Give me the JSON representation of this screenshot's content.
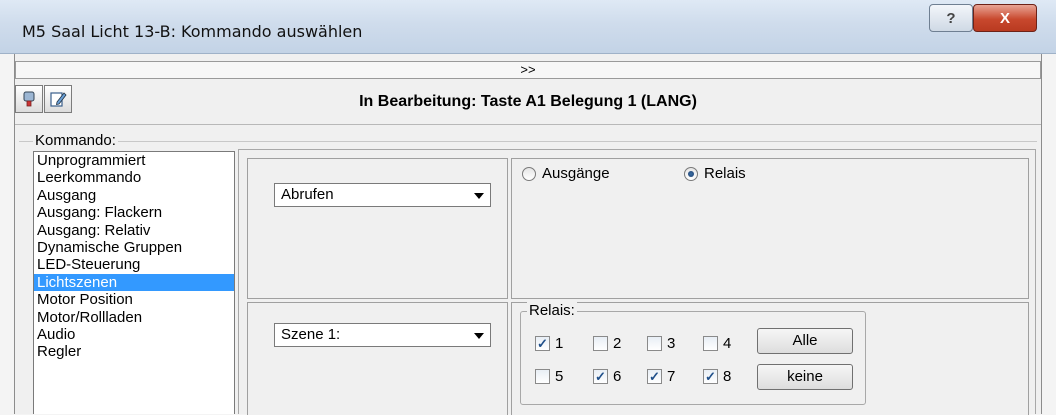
{
  "window": {
    "title": "M5 Saal Licht 13-B: Kommando auswählen",
    "help_label": "?",
    "close_label": "X"
  },
  "expand_label": ">>",
  "header_title": "In Bearbeitung: Taste A1 Belegung 1 (LANG)",
  "command_group_label": "Kommando:",
  "commands": [
    "Unprogrammiert",
    "Leerkommando",
    "Ausgang",
    "Ausgang: Flackern",
    "Ausgang: Relativ",
    "Dynamische Gruppen",
    "LED-Steuerung",
    "Lichtszenen",
    "Motor Position",
    "Motor/Rollladen",
    "Audio",
    "Regler"
  ],
  "selected_command": "Lichtszenen",
  "action_select": "Abrufen",
  "scene_select": "Szene 1:",
  "target_options": [
    {
      "label": "Ausgänge",
      "checked": false
    },
    {
      "label": "Relais",
      "checked": true
    }
  ],
  "relais_group_label": "Relais:",
  "relais": [
    {
      "label": "1",
      "checked": true
    },
    {
      "label": "2",
      "checked": false
    },
    {
      "label": "3",
      "checked": false
    },
    {
      "label": "4",
      "checked": false
    },
    {
      "label": "5",
      "checked": false
    },
    {
      "label": "6",
      "checked": true
    },
    {
      "label": "7",
      "checked": true
    },
    {
      "label": "8",
      "checked": true
    }
  ],
  "all_button": "Alle",
  "none_button": "keine",
  "colors": {
    "selection": "#3399ff",
    "close_button": "#c8482d"
  }
}
